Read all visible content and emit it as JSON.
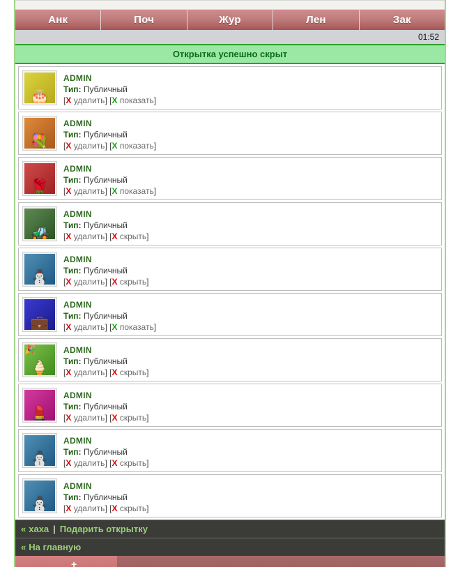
{
  "nav": {
    "tabs": [
      {
        "label": "Анк",
        "name": "tab-anketa"
      },
      {
        "label": "Поч",
        "name": "tab-pochta"
      },
      {
        "label": "Жур",
        "name": "tab-zhurnal"
      },
      {
        "label": "Лен",
        "name": "tab-lenta"
      },
      {
        "label": "Зак",
        "name": "tab-zakladki"
      }
    ]
  },
  "status": {
    "time": "01:52"
  },
  "notice": {
    "text": "Открытка успешно скрыт"
  },
  "labels": {
    "type_key": "Тип:",
    "type_value": "Публичный",
    "owner": "ADMIN",
    "delete": "удалить",
    "show": "показать",
    "hide": "скрыть",
    "x": "X",
    "bracket_open": "[",
    "bracket_close": "]"
  },
  "cards": [
    {
      "owner": "ADMIN",
      "type_key": "Тип:",
      "type_value": "Публичный",
      "delete": "удалить",
      "toggle": "показать",
      "toggle_state": "show",
      "thumb": {
        "name": "card-thumb-cake",
        "glyph": "🎂",
        "corner": "",
        "bg_top": "#d9d43c",
        "bg_bottom": "#b8a81e"
      }
    },
    {
      "owner": "ADMIN",
      "type_key": "Тип:",
      "type_value": "Публичный",
      "delete": "удалить",
      "toggle": "показать",
      "toggle_state": "show",
      "thumb": {
        "name": "card-thumb-flowers-ribbon",
        "glyph": "💐",
        "corner": "",
        "bg_top": "#e08a3a",
        "bg_bottom": "#a85a1c"
      }
    },
    {
      "owner": "ADMIN",
      "type_key": "Тип:",
      "type_value": "Публичный",
      "delete": "удалить",
      "toggle": "показать",
      "toggle_state": "show",
      "thumb": {
        "name": "card-thumb-red-flowers",
        "glyph": "🌹",
        "corner": "",
        "bg_top": "#cf4a4a",
        "bg_bottom": "#9e2222"
      }
    },
    {
      "owner": "ADMIN",
      "type_key": "Тип:",
      "type_value": "Публичный",
      "delete": "удалить",
      "toggle": "скрыть",
      "toggle_state": "hide",
      "thumb": {
        "name": "card-thumb-tank",
        "glyph": "🚜",
        "corner": "",
        "bg_top": "#5e8a52",
        "bg_bottom": "#2d5226"
      }
    },
    {
      "owner": "ADMIN",
      "type_key": "Тип:",
      "type_value": "Публичный",
      "delete": "удалить",
      "toggle": "скрыть",
      "toggle_state": "hide",
      "thumb": {
        "name": "card-thumb-snowman",
        "glyph": "⛄",
        "corner": "",
        "bg_top": "#4f8fb5",
        "bg_bottom": "#1f5a84"
      }
    },
    {
      "owner": "ADMIN",
      "type_key": "Тип:",
      "type_value": "Публичный",
      "delete": "удалить",
      "toggle": "показать",
      "toggle_state": "show",
      "thumb": {
        "name": "card-thumb-briefcase",
        "glyph": "💼",
        "corner": "",
        "bg_top": "#3a3ad0",
        "bg_bottom": "#1a1a8c"
      }
    },
    {
      "owner": "ADMIN",
      "type_key": "Тип:",
      "type_value": "Публичный",
      "delete": "удалить",
      "toggle": "скрыть",
      "toggle_state": "hide",
      "thumb": {
        "name": "card-thumb-icecream",
        "glyph": "🍦",
        "corner": "🎉",
        "bg_top": "#7fc24a",
        "bg_bottom": "#3f8a1e"
      }
    },
    {
      "owner": "ADMIN",
      "type_key": "Тип:",
      "type_value": "Публичный",
      "delete": "удалить",
      "toggle": "скрыть",
      "toggle_state": "hide",
      "thumb": {
        "name": "card-thumb-cosmetics",
        "glyph": "💄",
        "corner": "",
        "bg_top": "#d43a9e",
        "bg_bottom": "#a01070"
      }
    },
    {
      "owner": "ADMIN",
      "type_key": "Тип:",
      "type_value": "Публичный",
      "delete": "удалить",
      "toggle": "скрыть",
      "toggle_state": "hide",
      "thumb": {
        "name": "card-thumb-snowman",
        "glyph": "⛄",
        "corner": "",
        "bg_top": "#4f8fb5",
        "bg_bottom": "#1f5a84"
      }
    },
    {
      "owner": "ADMIN",
      "type_key": "Тип:",
      "type_value": "Публичный",
      "delete": "удалить",
      "toggle": "скрыть",
      "toggle_state": "hide",
      "thumb": {
        "name": "card-thumb-snowman",
        "glyph": "⛄",
        "corner": "",
        "bg_top": "#4f8fb5",
        "bg_bottom": "#1f5a84"
      }
    }
  ],
  "footer": {
    "row1": {
      "chevron": "«",
      "link": "хаха",
      "separator": "|",
      "link2": "Подарить открытку"
    },
    "row2": {
      "chevron": "«",
      "link": "На главную"
    }
  },
  "bottom_strip": {
    "plus": "+"
  },
  "colors": {
    "tab_bg": "#c07d7d",
    "notice_bg": "#9ae8a4",
    "notice_text": "#0a6d18",
    "status_bg": "#d2d3d7",
    "green_border": "#2aa02a",
    "side_border": "#9fd88a",
    "footer_bg": "#3b3b38",
    "footer_link": "#9ad17a",
    "delete_x": "#e00000",
    "show_x": "#0aa80a",
    "owner_text": "#2e6b1f"
  }
}
